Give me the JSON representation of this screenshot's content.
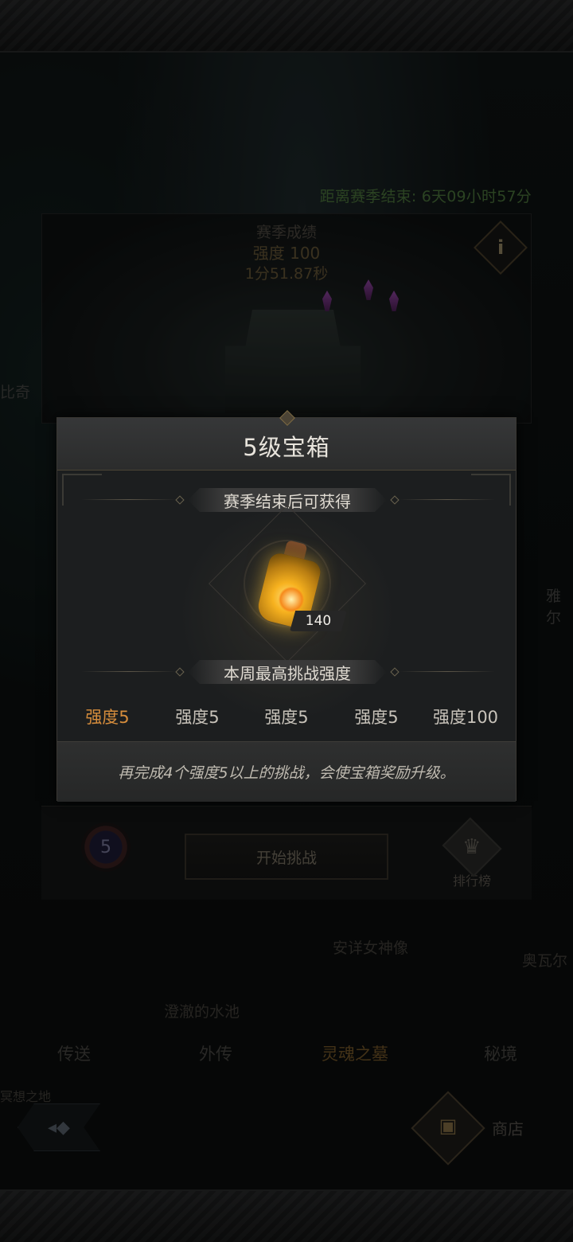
{
  "header": {
    "season_countdown": "距离赛季结束: 6天09小时57分"
  },
  "season_card": {
    "title": "赛季成绩",
    "intensity": "强度 100",
    "time": "1分51.87秒",
    "info_icon": "info-icon"
  },
  "side_labels": {
    "left": "比奇",
    "right": "雅尔"
  },
  "bottom_panel": {
    "rank_level": "5",
    "start_button": "开始挑战",
    "leaderboard": "排行榜"
  },
  "map_labels": {
    "statue": "安详女神像",
    "pool": "澄澈的水池",
    "right_edge": "奥瓦尔",
    "corner": "冥想之地"
  },
  "nav": {
    "tabs": [
      "传送",
      "外传",
      "灵魂之墓",
      "秘境"
    ],
    "active_index": 2,
    "shop": "商店"
  },
  "modal": {
    "title": "5级宝箱",
    "reward_ribbon": "赛季结束后可获得",
    "item_icon": "golden-bottle-icon",
    "item_count": "140",
    "intensity_ribbon": "本周最高挑战强度",
    "intensities": [
      "强度5",
      "强度5",
      "强度5",
      "强度5",
      "强度100"
    ],
    "current_index": 0,
    "footer": "再完成4个强度5以上的挑战，会使宝箱奖励升级。"
  },
  "colors": {
    "countdown": "#4f7a3e",
    "current_intensity": "#d68d3c",
    "title": "#e8e4dc"
  }
}
